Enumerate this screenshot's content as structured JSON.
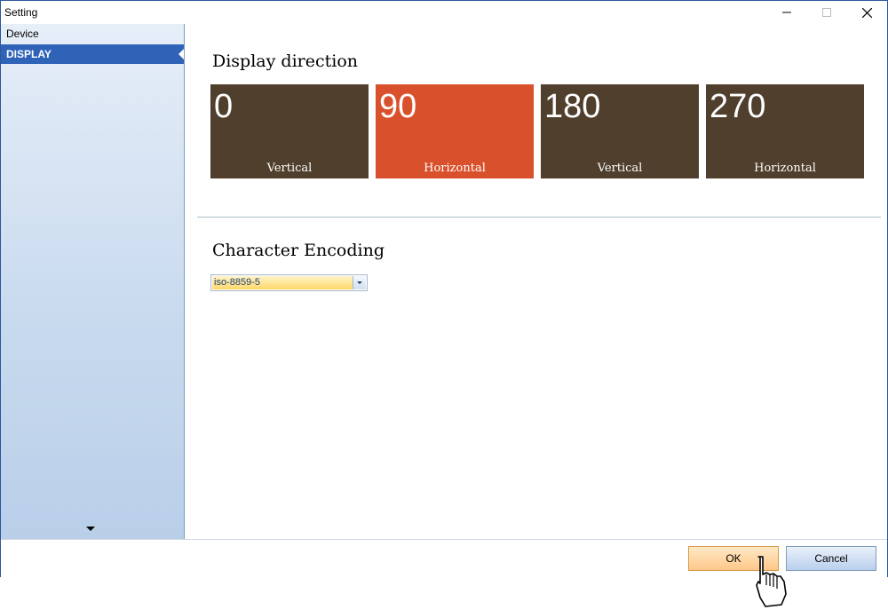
{
  "window": {
    "title": "Setting"
  },
  "sidebar": {
    "items": [
      {
        "label": "Device"
      },
      {
        "label": "DISPLAY"
      }
    ]
  },
  "display_direction": {
    "title": "Display direction",
    "tiles": [
      {
        "value": "0",
        "label": "Vertical",
        "color": "#4f3f2c",
        "selected": false
      },
      {
        "value": "90",
        "label": "Horizontal",
        "color": "#d9512c",
        "selected": true
      },
      {
        "value": "180",
        "label": "Vertical",
        "color": "#4f3f2c",
        "selected": false
      },
      {
        "value": "270",
        "label": "Horizontal",
        "color": "#4f3f2c",
        "selected": false
      }
    ]
  },
  "character_encoding": {
    "title": "Character Encoding",
    "selected": "iso-8859-5"
  },
  "footer": {
    "ok_label": "OK",
    "cancel_label": "Cancel"
  },
  "colors": {
    "accent": "#2e63b8",
    "tile_dark": "#4f3f2c",
    "tile_selected": "#d9512c"
  }
}
